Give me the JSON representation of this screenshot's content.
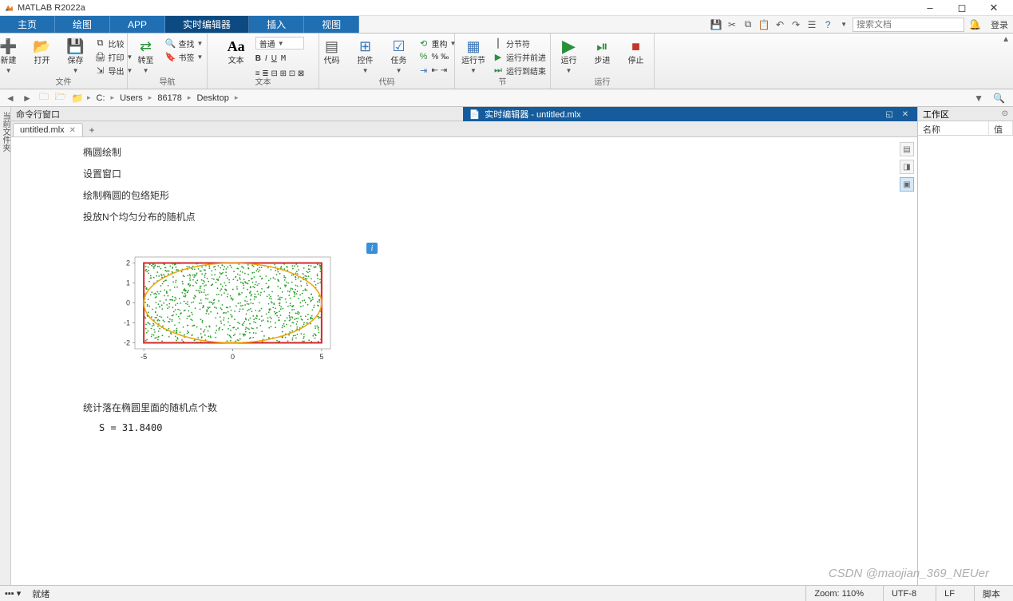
{
  "app": {
    "title": "MATLAB R2022a"
  },
  "window_controls": {
    "min": "–",
    "max": "◻",
    "close": "✕"
  },
  "tabs": {
    "items": [
      "主页",
      "绘图",
      "APP",
      "实时编辑器",
      "插入",
      "视图"
    ],
    "active_index": 3
  },
  "quick_access": {
    "search_placeholder": "搜索文档",
    "login": "登录"
  },
  "ribbon": {
    "file": {
      "new": "新建",
      "open": "打开",
      "save": "保存",
      "compare": "比较",
      "print": "打印",
      "export": "导出",
      "group": "文件"
    },
    "nav": {
      "goto": "转至",
      "find": "查找",
      "bookmark": "书签",
      "group": "导航"
    },
    "text": {
      "label": "文本",
      "normal": "普通",
      "group": "文本"
    },
    "code": {
      "code": "代码",
      "control": "控件",
      "task": "任务",
      "run_section": "运行节",
      "refactor": "重构",
      "group": "代码"
    },
    "section": {
      "sec_break": "分节符",
      "run_advance": "运行并前进",
      "run_to_end": "运行到结束",
      "group": "节"
    },
    "run": {
      "run": "运行",
      "step": "步进",
      "stop": "停止",
      "group": "运行"
    }
  },
  "addressbar": {
    "drive": "C:",
    "p1": "Users",
    "p2": "86178",
    "p3": "Desktop"
  },
  "left_dock": {
    "label": "当前文件夹"
  },
  "cmdwin": {
    "title": "命令行窗口"
  },
  "editor_header": {
    "title": "实时编辑器 - untitled.mlx"
  },
  "file_tabs": {
    "name": "untitled.mlx"
  },
  "content": {
    "l1": "椭圆绘制",
    "l2": "设置窗口",
    "l3": "绘制椭圆的包络矩形",
    "l4": "投放N个均匀分布的随机点",
    "l5": "统计落在椭圆里面的随机点个数",
    "result": "S = 31.8400"
  },
  "chart_data": {
    "type": "scatter",
    "xlim": [
      -5.5,
      5.5
    ],
    "ylim": [
      -2.3,
      2.3
    ],
    "xticks": [
      -5,
      0,
      5
    ],
    "yticks": [
      -2,
      -1,
      0,
      1,
      2
    ],
    "rectangle": {
      "x0": -5,
      "y0": -2,
      "x1": 5,
      "y1": 2,
      "color": "#d62728"
    },
    "ellipse": {
      "cx": 0,
      "cy": 0,
      "rx": 5,
      "ry": 2,
      "color": "#f0a30a"
    },
    "points": {
      "n": 1000,
      "color": "#2ca02c",
      "x_range": [
        -5,
        5
      ],
      "y_range": [
        -2,
        2
      ]
    }
  },
  "workspace": {
    "title": "工作区",
    "col_name": "名称",
    "col_val": "值"
  },
  "statusbar": {
    "ready": "就绪",
    "zoom": "Zoom: 110%",
    "encoding": "UTF-8",
    "lf": "LF",
    "script": "脚本"
  },
  "watermark": "CSDN @maojian_369_NEUer"
}
